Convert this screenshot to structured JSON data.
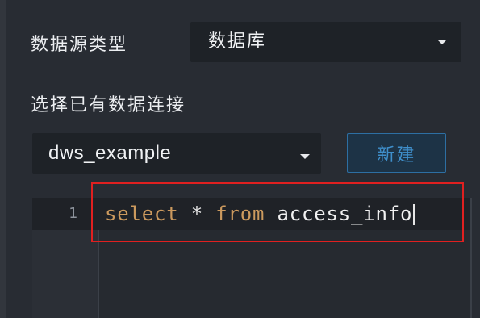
{
  "form": {
    "datasource_type": {
      "label": "数据源类型",
      "value": "数据库"
    },
    "connection": {
      "label": "选择已有数据连接",
      "value": "dws_example",
      "new_button": "新建"
    }
  },
  "editor": {
    "lines": [
      {
        "number": "1",
        "tokens": [
          {
            "text": "select",
            "color": "#cc9a5e"
          },
          {
            "text": " * ",
            "color": "#e8e8e8"
          },
          {
            "text": "from",
            "color": "#cc9a5e"
          },
          {
            "text": " access_info",
            "color": "#f2f2f2"
          }
        ]
      }
    ]
  },
  "icons": {
    "dropdown": "caret-down-icon"
  },
  "colors": {
    "background": "#282c33",
    "input_background": "#1e2227",
    "button_border": "#2d6fa3",
    "button_background": "#1d3346",
    "button_text": "#3f8fcb",
    "keyword": "#cc9a5e",
    "highlight_border": "#e02020"
  }
}
